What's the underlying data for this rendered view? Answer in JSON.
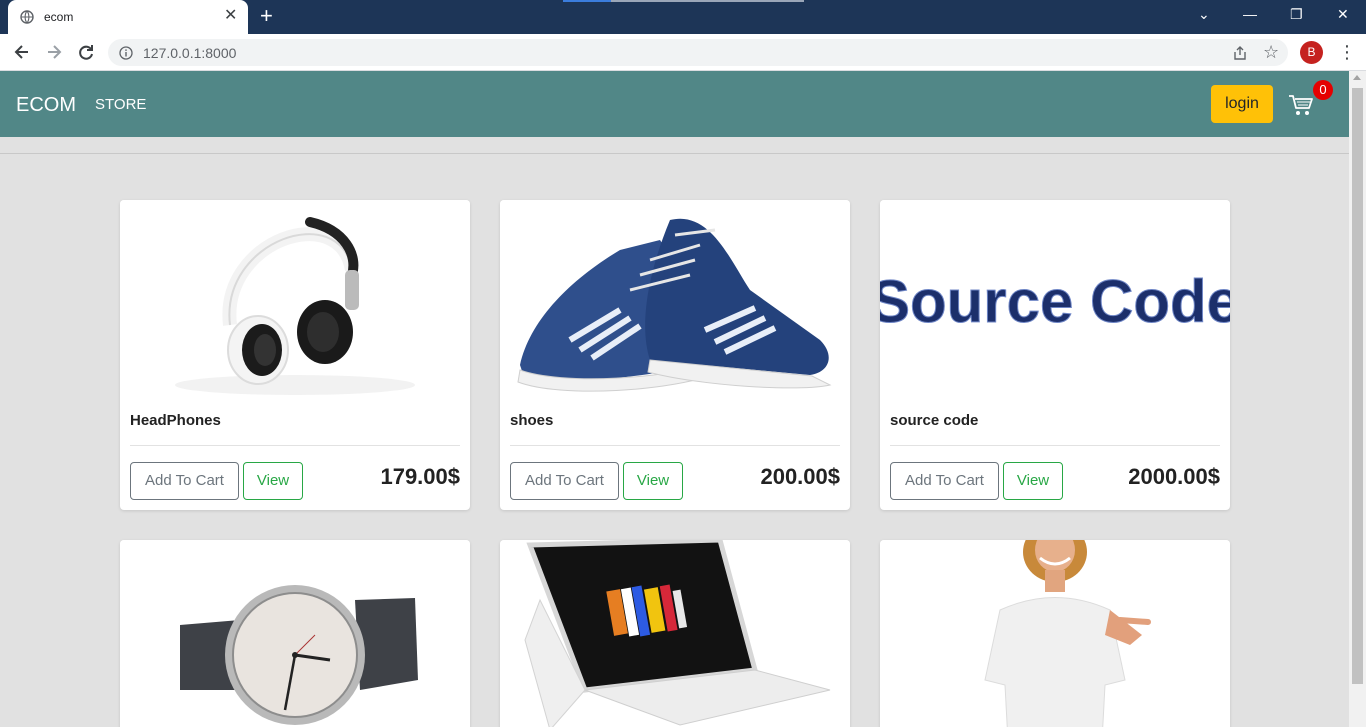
{
  "browser": {
    "tab_title": "ecom",
    "tab_close": "✕",
    "new_tab": "+",
    "url": "127.0.0.1:8000",
    "profile_initial": "B",
    "window_controls": {
      "chevron": "⌄",
      "minimize": "—",
      "restore": "❐",
      "close": "✕"
    },
    "menu": "⋮",
    "star": "☆"
  },
  "navbar": {
    "brand": "ECOM",
    "store_link": "STORE",
    "login_label": "login",
    "cart_count": "0",
    "bg_color": "#518787"
  },
  "products": [
    {
      "name": "HeadPhones",
      "price": "179.00$",
      "image": "headphones-image"
    },
    {
      "name": "shoes",
      "price": "200.00$",
      "image": "shoes-image"
    },
    {
      "name": "source code",
      "price": "2000.00$",
      "image": "source-code-image",
      "image_text": "Source Code"
    },
    {
      "name": "",
      "price": "",
      "image": "watch-image"
    },
    {
      "name": "",
      "price": "",
      "image": "laptop-image"
    },
    {
      "name": "",
      "price": "",
      "image": "tshirt-image"
    }
  ],
  "card_buttons": {
    "add_to_cart": "Add To Cart",
    "view": "View"
  },
  "colors": {
    "accent": "#ffc107",
    "badge": "#e50000",
    "view_button": "#28a745",
    "add_button": "#6c757d"
  }
}
